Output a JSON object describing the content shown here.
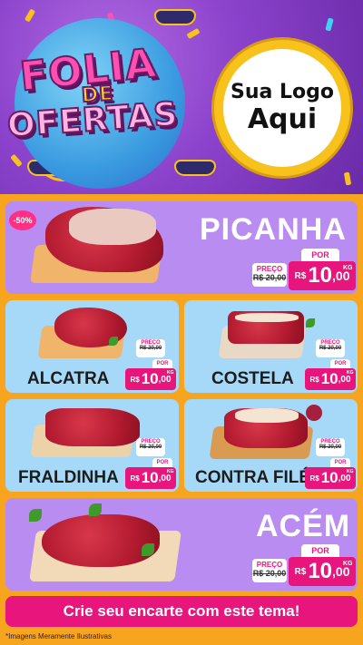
{
  "header": {
    "title_line1": "FOLIA",
    "title_line2": "DE",
    "title_line3": "OFERTAS",
    "logo_line1": "Sua Logo",
    "logo_line2": "Aqui"
  },
  "products": {
    "picanha": {
      "name": "PICANHA",
      "badge": "-50%",
      "preco_label": "PREÇO",
      "old_price": "R$ 20,00",
      "por_label": "POR",
      "currency": "R$",
      "price_int": "10",
      "price_dec": ",00",
      "unit": "KG"
    },
    "alcatra": {
      "name": "ALCATRA",
      "preco_label": "PREÇO",
      "old_price": "R$ 20,00",
      "por_label": "POR",
      "currency": "R$",
      "price_int": "10",
      "price_dec": ",00",
      "unit": "KG"
    },
    "costela": {
      "name": "COSTELA",
      "preco_label": "PREÇO",
      "old_price": "R$ 20,00",
      "por_label": "POR",
      "currency": "R$",
      "price_int": "10",
      "price_dec": ",00",
      "unit": "KG"
    },
    "fraldinha": {
      "name": "FRALDINHA",
      "preco_label": "PREÇO",
      "old_price": "R$ 20,00",
      "por_label": "POR",
      "currency": "R$",
      "price_int": "10",
      "price_dec": ",00",
      "unit": "KG"
    },
    "contra_file": {
      "name": "CONTRA FILÉ",
      "preco_label": "PREÇO",
      "old_price": "R$ 20,00",
      "por_label": "POR",
      "currency": "R$",
      "price_int": "10",
      "price_dec": ",00",
      "unit": "KG"
    },
    "acem": {
      "name": "ACÉM",
      "preco_label": "PREÇO",
      "old_price": "R$ 20,00",
      "por_label": "POR",
      "currency": "R$",
      "price_int": "10",
      "price_dec": ",00",
      "unit": "KG"
    }
  },
  "footer": {
    "cta": "Crie seu encarte com este tema!",
    "disclaimer": "*Imagens Meramente Ilustrativas"
  },
  "colors": {
    "background": "#f7a51f",
    "header_purple": "#8b42cc",
    "card_lilac": "#b88cf0",
    "card_blue": "#a6d9f7",
    "accent_pink": "#e8157d",
    "gold": "#f6c21b"
  }
}
